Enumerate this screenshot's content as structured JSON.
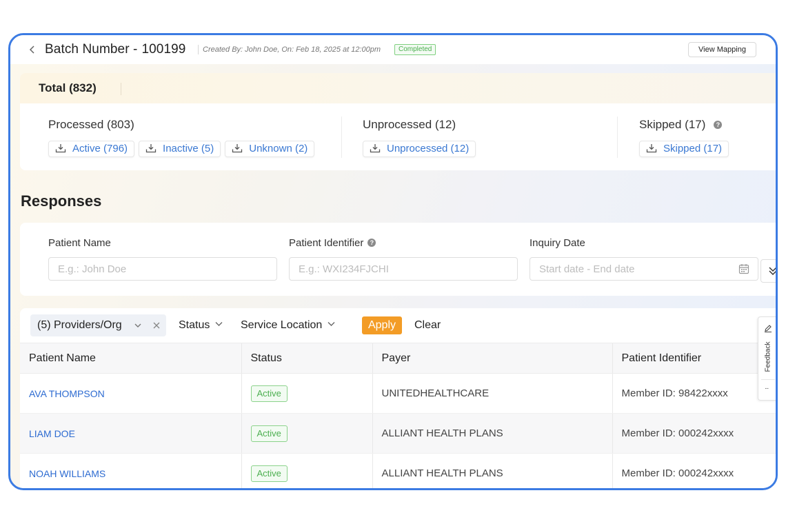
{
  "header": {
    "back_icon": "chevron-left-icon",
    "title_label": "Batch Number -",
    "batch_number": "100199",
    "created_meta": "Created By: John Doe, On: Feb 18, 2025 at 12:00pm",
    "status": "Completed",
    "view_mapping_label": "View Mapping"
  },
  "summary": {
    "total_label": "Total (832)",
    "processed": {
      "title": "Processed (803)",
      "chips": [
        "Active (796)",
        "Inactive (5)",
        "Unknown (2)"
      ]
    },
    "unprocessed": {
      "title": "Unprocessed (12)",
      "chips": [
        "Unprocessed (12)"
      ]
    },
    "skipped": {
      "title": "Skipped (17)",
      "chips": [
        "Skipped (17)"
      ]
    }
  },
  "responses": {
    "title": "Responses",
    "filters": {
      "patient_name": {
        "label": "Patient Name",
        "placeholder": "E.g.: John Doe"
      },
      "patient_identifier": {
        "label": "Patient Identifier",
        "placeholder": "E.g.: WXI234FJCHI"
      },
      "inquiry_date": {
        "label": "Inquiry Date",
        "placeholder": "Start date - End date"
      }
    },
    "toolbar": {
      "providers_label": "(5) Providers/Org",
      "status_label": "Status",
      "service_location_label": "Service Location",
      "apply_label": "Apply",
      "clear_label": "Clear"
    },
    "table": {
      "columns": [
        "Patient Name",
        "Status",
        "Payer",
        "Patient Identifier"
      ],
      "rows": [
        {
          "name": "AVA THOMPSON",
          "status": "Active",
          "payer": "UNITEDHEALTHCARE",
          "identifier": "Member ID: 98422xxxx"
        },
        {
          "name": "LIAM DOE",
          "status": "Active",
          "payer": "ALLIANT HEALTH PLANS",
          "identifier": "Member ID: 000242xxxx"
        },
        {
          "name": "NOAH WILLIAMS",
          "status": "Active",
          "payer": "ALLIANT HEALTH PLANS",
          "identifier": "Member ID: 000242xxxx"
        }
      ]
    }
  },
  "feedback": {
    "label": "Feedback",
    "more": "..."
  },
  "colors": {
    "frame_border": "#3b7be3",
    "link_blue": "#3a78d2",
    "apply_orange": "#f39c26",
    "active_green": "#4caf50"
  },
  "icons": [
    "chevron-left-icon",
    "download-icon",
    "help-circle-icon",
    "calendar-icon",
    "double-chevron-down-icon",
    "chevron-down-icon",
    "close-icon",
    "edit-icon"
  ]
}
